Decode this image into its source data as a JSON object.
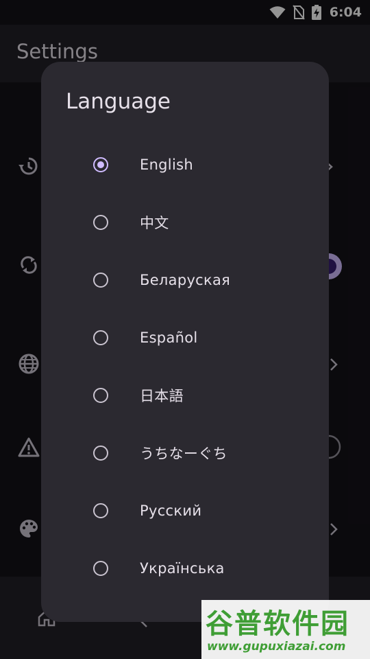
{
  "status_bar": {
    "time": "6:04"
  },
  "app": {
    "title": "Settings"
  },
  "dialog": {
    "title": "Language",
    "options": [
      {
        "label": "English",
        "selected": true
      },
      {
        "label": "中文",
        "selected": false
      },
      {
        "label": "Беларуская",
        "selected": false
      },
      {
        "label": "Español",
        "selected": false
      },
      {
        "label": "日本語",
        "selected": false
      },
      {
        "label": "うちなーぐち",
        "selected": false
      },
      {
        "label": "Русский",
        "selected": false
      },
      {
        "label": "Українська",
        "selected": false
      }
    ]
  },
  "watermark": {
    "text": "谷普软件园",
    "url": "www.gupuxiazai.com"
  },
  "colors": {
    "accent": "#d0bcff",
    "dialog_bg": "#2b2930",
    "background": "#141218"
  }
}
